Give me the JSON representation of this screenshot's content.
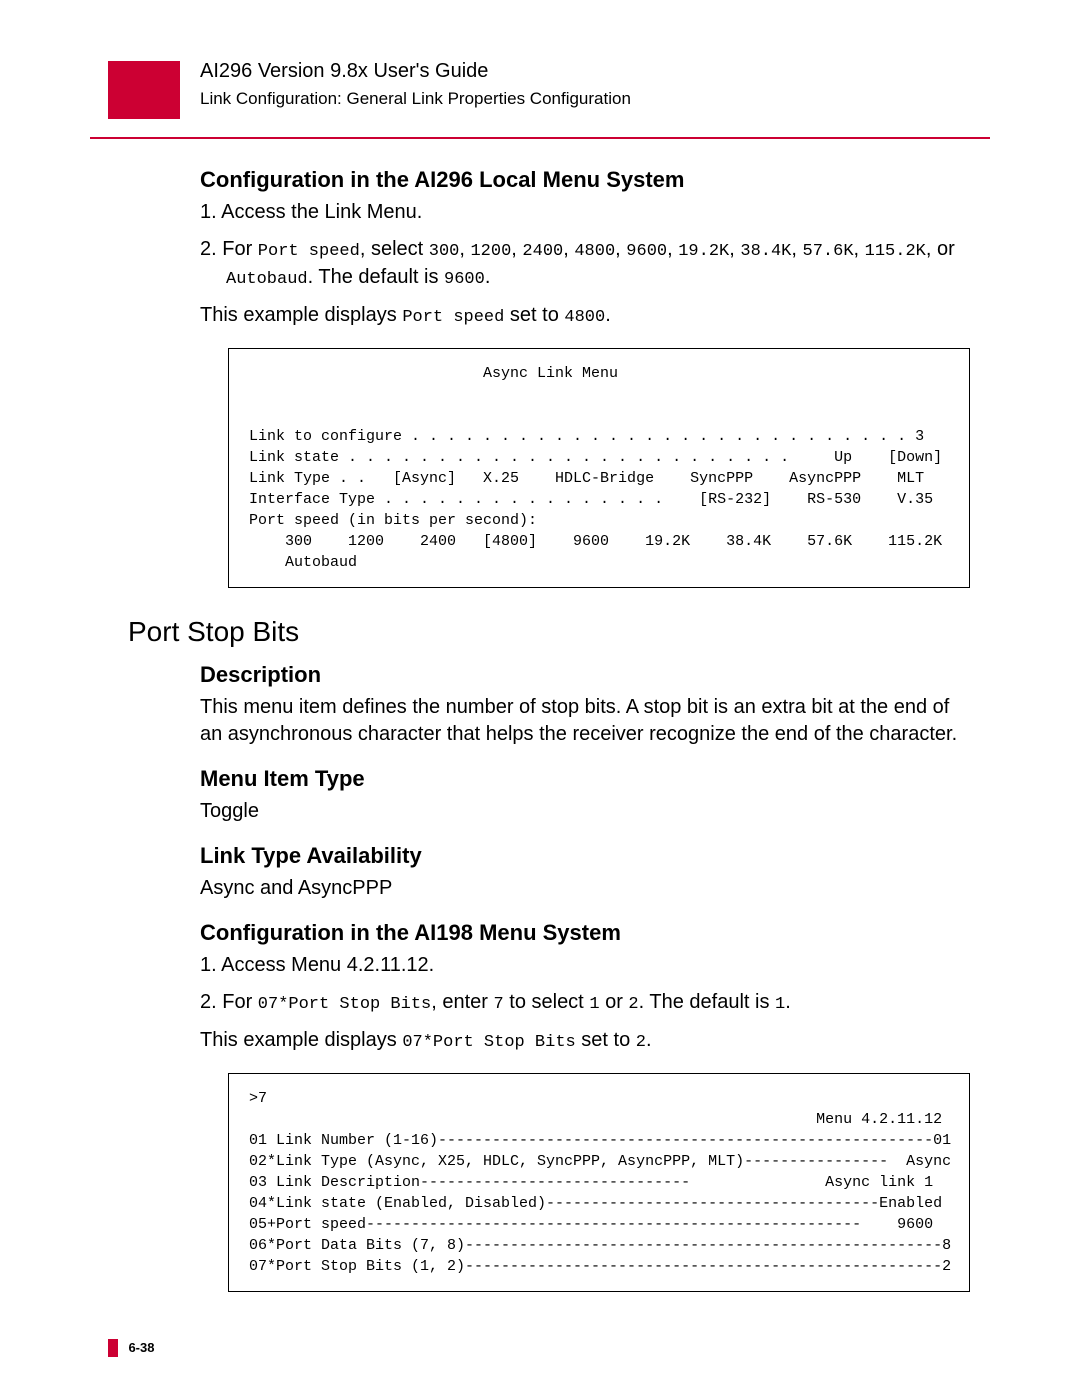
{
  "header": {
    "title": "AI296 Version 9.8x User's Guide",
    "subtitle": "Link Configuration: General Link Properties Configuration"
  },
  "section1": {
    "heading": "Configuration in the AI296 Local Menu System",
    "step1": "1.  Access the Link Menu.",
    "step2_a": "2.  For ",
    "step2_b": "Port speed",
    "step2_c": ", select ",
    "step2_d": "300",
    "step2_e": ", ",
    "step2_f": "1200",
    "step2_g": ", ",
    "step2_h": "2400",
    "step2_i": ", ",
    "step2_j": "4800",
    "step2_k": ", ",
    "step2_l": "9600",
    "step2_m": ", ",
    "step2_n": "19.2K",
    "step2_o": ", ",
    "step2_p": "38.4K",
    "step2_q": ", ",
    "step2_r": "57.6K",
    "step2_s": ", ",
    "step2_t": "115.2K",
    "step2_u": ", or ",
    "step2_v": "Autobaud",
    "step2_w": ". The default is ",
    "step2_x": "9600",
    "step2_y": ".",
    "example_a": "This example displays ",
    "example_b": "Port speed",
    "example_c": " set to ",
    "example_d": "4800",
    "example_e": ".",
    "code": "                          Async Link Menu\n\n\nLink to configure . . . . . . . . . . . . . . . . . . . . . . . . . . . . 3\nLink state . . . . . . . . . . . . . . . . . . . . . . . . .     Up    [Down]\nLink Type . .   [Async]   X.25    HDLC-Bridge    SyncPPP    AsyncPPP    MLT\nInterface Type . . . . . . . . . . . . . . . .    [RS-232]    RS-530    V.35\nPort speed (in bits per second):\n    300    1200    2400   [4800]    9600    19.2K    38.4K    57.6K    115.2K\n    Autobaud"
  },
  "section2": {
    "title": "Port Stop Bits",
    "desc_head": "Description",
    "desc_text": "This menu item defines the number of stop bits. A stop bit is an extra bit at the end of an asynchronous character that helps the receiver recognize the end of the character.",
    "type_head": "Menu Item Type",
    "type_text": "Toggle",
    "avail_head": "Link Type Availability",
    "avail_text": "Async and AsyncPPP",
    "cfg_head": "Configuration in the AI198 Menu System",
    "step1": "1.  Access Menu 4.2.11.12.",
    "step2_a": "2.  For ",
    "step2_b": "07*Port Stop Bits",
    "step2_c": ", enter ",
    "step2_d": "7",
    "step2_e": " to select ",
    "step2_f": "1",
    "step2_g": " or ",
    "step2_h": "2",
    "step2_i": ". The default is ",
    "step2_j": "1",
    "step2_k": ".",
    "example_a": "This example displays ",
    "example_b": "07*Port Stop Bits",
    "example_c": " set to ",
    "example_d": "2",
    "example_e": ".",
    "code": ">7\n                                                               Menu 4.2.11.12\n01 Link Number (1-16)-------------------------------------------------------01\n02*Link Type (Async, X25, HDLC, SyncPPP, AsyncPPP, MLT)----------------  Async\n03 Link Description------------------------------               Async link 1\n04*Link state (Enabled, Disabled)-------------------------------------Enabled\n05+Port speed-------------------------------------------------------    9600\n06*Port Data Bits (7, 8)-----------------------------------------------------8\n07*Port Stop Bits (1, 2)-----------------------------------------------------2"
  },
  "footer": {
    "page": "6-38"
  }
}
